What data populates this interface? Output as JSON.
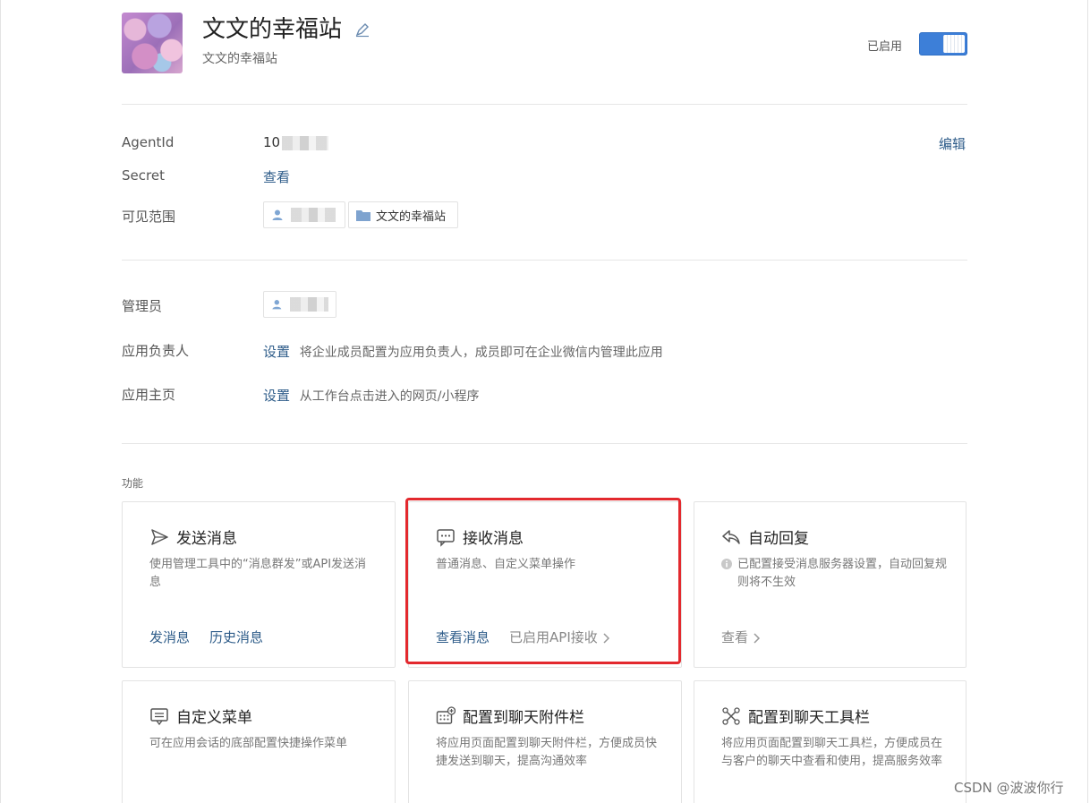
{
  "header": {
    "app_name": "文文的幸福站",
    "app_subtitle": "文文的幸福站",
    "status_label": "已启用",
    "enabled": true
  },
  "info": {
    "agentid_label": "AgentId",
    "agentid_value": "10",
    "edit_label": "编辑",
    "secret_label": "Secret",
    "secret_action": "查看",
    "visibility_label": "可见范围",
    "visibility_dept": "文文的幸福站"
  },
  "admin": {
    "admin_label": "管理员",
    "owner_label": "应用负责人",
    "owner_action": "设置",
    "owner_desc": "将企业成员配置为应用负责人，成员即可在企业微信内管理此应用",
    "home_label": "应用主页",
    "home_action": "设置",
    "home_desc": "从工作台点击进入的网页/小程序"
  },
  "features": {
    "section_title": "功能",
    "cards": [
      {
        "title": "发送消息",
        "icon": "send-icon",
        "desc": "使用管理工具中的“消息群发”或API发送消息",
        "actions": [
          "发消息",
          "历史消息"
        ]
      },
      {
        "title": "接收消息",
        "icon": "chat-bubble-icon",
        "desc": "普通消息、自定义菜单操作",
        "actions": [
          "查看消息"
        ],
        "status": "已启用API接收"
      },
      {
        "title": "自动回复",
        "icon": "reply-icon",
        "desc": "已配置接受消息服务器设置，自动回复规则将不生效",
        "actions": [
          "查看"
        ]
      },
      {
        "title": "自定义菜单",
        "icon": "menu-icon",
        "desc": "可在应用会话的底部配置快捷操作菜单"
      },
      {
        "title": "配置到聊天附件栏",
        "icon": "attachment-grid-icon",
        "desc": "将应用页面配置到聊天附件栏，方便成员快捷发送到聊天，提高沟通效率"
      },
      {
        "title": "配置到聊天工具栏",
        "icon": "toolbar-icon",
        "desc": "将应用页面配置到聊天工具栏，方便成员在与客户的聊天中查看和使用，提高服务效率"
      }
    ]
  },
  "watermark": "CSDN @波波你行",
  "colors": {
    "accent": "#3d7fd8",
    "link": "#2f5d8a",
    "highlight": "#e3292e"
  }
}
